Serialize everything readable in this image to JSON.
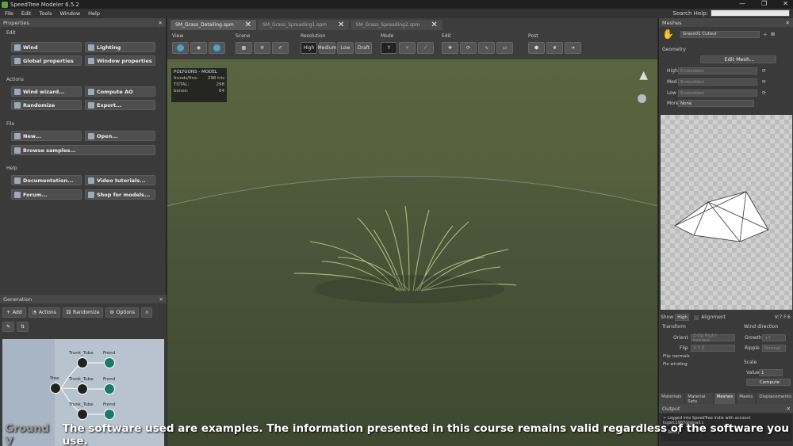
{
  "app": {
    "title": "SpeedTree  Modeler 6.5.2",
    "win_buttons": [
      "—",
      "❐",
      "✕"
    ]
  },
  "menu": {
    "items": [
      "File",
      "Edit",
      "Tools",
      "Window",
      "Help"
    ],
    "search_label": "Search Help:"
  },
  "properties": {
    "title": "Properties",
    "edit": {
      "label": "Edit",
      "buttons": [
        "Wind",
        "Lighting",
        "Global properties",
        "Window properties"
      ]
    },
    "actions": {
      "label": "Actions",
      "buttons": [
        "Wind wizard...",
        "Compute AO",
        "Randomize",
        "Export..."
      ]
    },
    "file": {
      "label": "File",
      "buttons": [
        "New...",
        "Open...",
        "Browse samples..."
      ]
    },
    "help": {
      "label": "Help",
      "buttons": [
        "Documentation...",
        "Video tutorials...",
        "Forum...",
        "Shop for models..."
      ]
    }
  },
  "generation": {
    "title": "Generation",
    "toolbar": [
      "Add",
      "Actions",
      "Randomize",
      "Options"
    ],
    "nodes": {
      "tree": "Tree",
      "trunk_tube": "Trunk_Tube",
      "frond": "Frond"
    }
  },
  "viewport": {
    "tabs": [
      "SM_Grass_Detailing.spm",
      "SM_Grass_Spreading1.spm",
      "SM_Grass_Spreading2.spm"
    ],
    "groups": [
      "View",
      "Scene",
      "Resolution",
      "Mode",
      "Edit",
      "Post"
    ],
    "resolution": [
      "High",
      "Medium",
      "Low",
      "Draft"
    ],
    "stats": {
      "header": "POLYGONS - MODEL",
      "rows": [
        {
          "k": "fronds/fins:",
          "v": "298 tris"
        },
        {
          "k": "TOTAL:",
          "v": "298"
        },
        {
          "k": "bones:",
          "v": "64"
        }
      ]
    }
  },
  "meshes": {
    "title": "Meshes",
    "selected": "Grass01 Cutout",
    "geometry_label": "Geometry",
    "edit_mesh": "Edit Mesh...",
    "lods": [
      {
        "label": "High",
        "value": "Embedded"
      },
      {
        "label": "Med",
        "value": "Embedded"
      },
      {
        "label": "Low",
        "value": "Embedded"
      }
    ],
    "more_label": "More",
    "more_value": "None",
    "show_label": "Show",
    "show_value": "High",
    "alignment_label": "Alignment",
    "vf": "V:7 F:6",
    "transform": {
      "label": "Transform",
      "orient_label": "Orient",
      "orient_value": "Z-Up Right-handed",
      "flip_label": "Flip",
      "flip_value": "X Y Z",
      "flip_normals": "Flip normals",
      "fix_winding": "Fix winding"
    },
    "wind": {
      "label": "Wind direction",
      "growth_label": "Growth",
      "growth_value": "+Y",
      "ripple_label": "Ripple",
      "ripple_value": "Normal"
    },
    "scale": {
      "label": "Scale",
      "value_label": "Value",
      "value": "1",
      "compute": "Compute"
    },
    "bottom_tabs": [
      "Materials",
      "Material Sets",
      "Meshes",
      "Masks",
      "Displacements"
    ]
  },
  "output": {
    "title": "Output",
    "lines": [
      "> Logged into SpeedTree Indie with account tsgarc1987@gmail.c",
      ">",
      "> Ready"
    ]
  },
  "caption": {
    "prefix": "Ground V",
    "text": "The software used are examples. The information presented in this course remains valid regardless of the software you use."
  }
}
